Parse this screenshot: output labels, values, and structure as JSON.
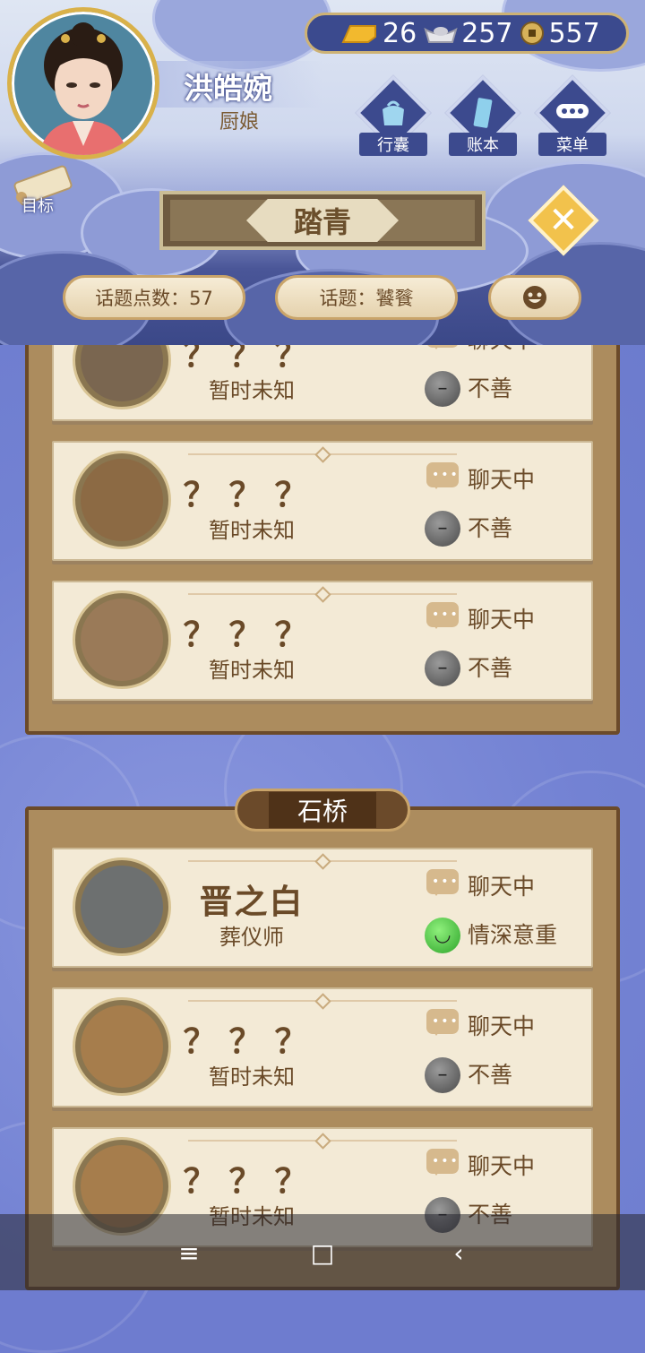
{
  "player": {
    "name": "洪皓婉",
    "title": "厨娘"
  },
  "goal_label": "目标",
  "currency": {
    "gold": "26",
    "silver": "257",
    "coin": "557"
  },
  "nav": [
    {
      "label": "行囊",
      "icon": "bag-icon"
    },
    {
      "label": "账本",
      "icon": "ledger-icon"
    },
    {
      "label": "菜单",
      "icon": "menu-dots-icon"
    }
  ],
  "banner_title": "踏青",
  "topic_points_label": "话题点数：57",
  "topic_label": "话题：饕餮",
  "emoji_icon": "smiley-icon",
  "section_place": "石桥",
  "cards": [
    {
      "name": "？？？",
      "role": "暂时未知",
      "status": "聊天中",
      "relation": "不善",
      "mood": "bad"
    },
    {
      "name": "？？？",
      "role": "暂时未知",
      "status": "聊天中",
      "relation": "不善",
      "mood": "bad"
    },
    {
      "name": "？？？",
      "role": "暂时未知",
      "status": "聊天中",
      "relation": "不善",
      "mood": "bad"
    },
    {
      "name": "晋之白",
      "role": "葬仪师",
      "status": "聊天中",
      "relation": "情深意重",
      "mood": "good"
    },
    {
      "name": "？？？",
      "role": "暂时未知",
      "status": "聊天中",
      "relation": "不善",
      "mood": "bad"
    },
    {
      "name": "？？？",
      "role": "暂时未知",
      "status": "聊天中",
      "relation": "不善",
      "mood": "bad"
    }
  ],
  "system_nav": {
    "menu": "≡",
    "home": "□",
    "back": "‹"
  }
}
